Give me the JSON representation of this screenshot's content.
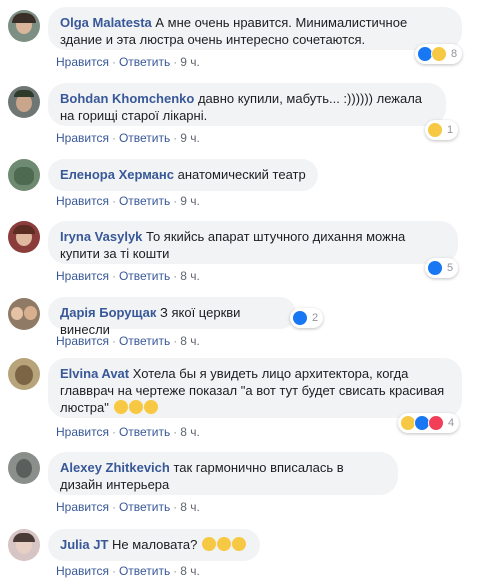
{
  "comments": [
    {
      "author": "Olga Malatesta",
      "text": "А мне очень нравится. Минималистичное здание и эта люстра очень интересно сочетаются.",
      "time": "9 ч.",
      "reaction_count": "8",
      "reactions": [
        "like",
        "haha"
      ]
    },
    {
      "author": "Bohdan Khomchenko",
      "text": "давно купили, мабуть... :)))))) лежала на горищі старої лікарні.",
      "time": "9 ч.",
      "reaction_count": "1",
      "reactions": [
        "haha"
      ]
    },
    {
      "author": "Еленора Херманс",
      "text": "анатомический театр",
      "time": "9 ч.",
      "reaction_count": "",
      "reactions": []
    },
    {
      "author": "Iryna Vasylyk",
      "text": "То якийсь апарат штучного дихання можна купити за ті кошти",
      "time": "8 ч.",
      "reaction_count": "5",
      "reactions": [
        "like"
      ]
    },
    {
      "author": "Дарія Борущак",
      "text": "З якої церкви винесли",
      "time": "8 ч.",
      "reaction_count": "2",
      "reactions": [
        "like"
      ]
    },
    {
      "author": "Elvina Avat",
      "text": "Хотела бы я увидеть лицо архитектора, когда главврач на чертеже показал \"а вот тут будет свисать красивая люстра\"",
      "time": "8 ч.",
      "reaction_count": "4",
      "reactions": [
        "haha",
        "like",
        "love"
      ]
    },
    {
      "author": "Alexey Zhitkevich",
      "text": "так гармонично вписалась в дизайн интерьера",
      "time": "8 ч.",
      "reaction_count": "",
      "reactions": []
    },
    {
      "author": "Julia JT",
      "text": "Не маловата?",
      "time": "8 ч.",
      "reaction_count": "",
      "reactions": []
    }
  ],
  "labels": {
    "like": "Нравится",
    "reply": "Ответить",
    "dot": "·"
  },
  "colors": {
    "link": "#385898",
    "bubble": "#f2f3f5",
    "like": "#1877f2",
    "haha": "#f7c844",
    "love": "#f33e58"
  }
}
